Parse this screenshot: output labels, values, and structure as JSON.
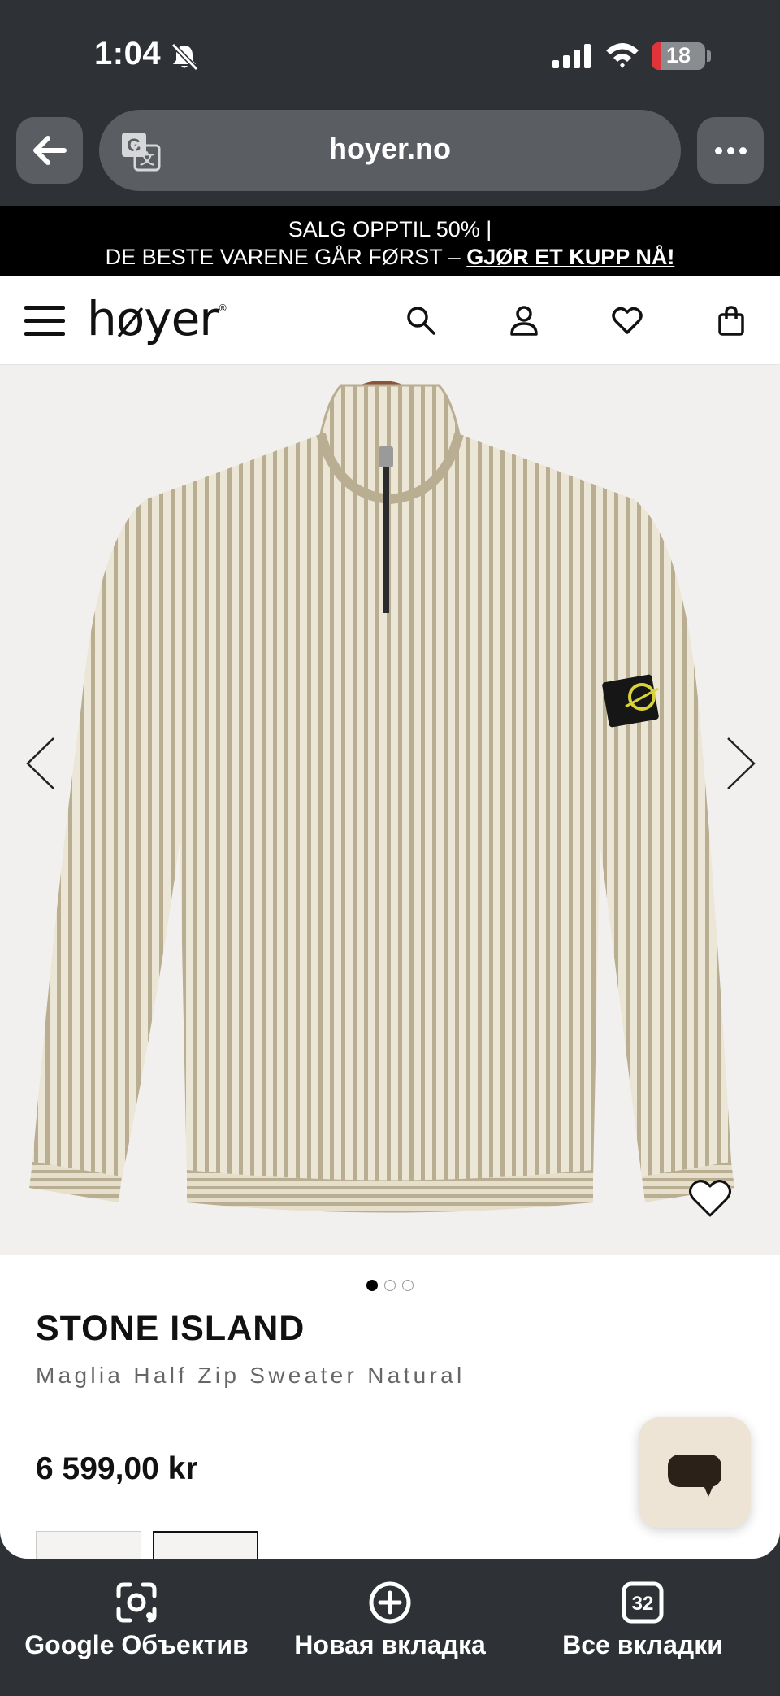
{
  "status_bar": {
    "time": "1:04",
    "battery": "18",
    "battery_level": 0.18
  },
  "browser": {
    "url": "hoyer.no"
  },
  "promo": {
    "line1": "SALG OPPTIL 50% |",
    "line2": "DE BESTE VARENE GÅR FØRST – ",
    "link": "GJØR ET KUPP NÅ!"
  },
  "header": {
    "logo": "høyer"
  },
  "product": {
    "brand": "STONE ISLAND",
    "name": "Maglia Half Zip Sweater Natural",
    "price": "6 599,00 kr",
    "image_count": 3,
    "active_image": 1
  },
  "bottom_bar": {
    "lens_label": "Google Объектив",
    "new_tab_label": "Новая вкладка",
    "tabs_label": "Все вкладки",
    "tabs_count": "32"
  },
  "colors": {
    "chrome": "#2e3236",
    "chrome_button": "#5a5e62",
    "sweater": "#ece6d6",
    "sweater_rib": "#b9ad92",
    "chat_button": "#eee4d6"
  }
}
